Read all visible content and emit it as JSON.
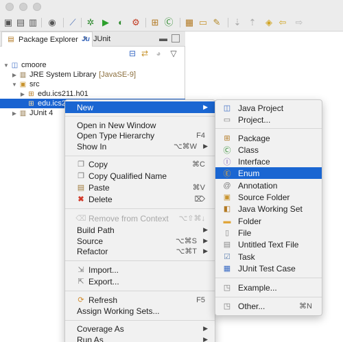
{
  "package_explorer": {
    "tab_label": "Package Explorer",
    "junit_tab_label": "JUnit",
    "tree": [
      {
        "label": "cmoore",
        "level": 0
      },
      {
        "label": "JRE System Library",
        "decoration": "[JavaSE-9]",
        "level": 1
      },
      {
        "label": "src",
        "level": 1
      },
      {
        "label": "edu.ics211.h01",
        "level": 2
      },
      {
        "label": "edu.ics2",
        "level": 2,
        "selected": true
      },
      {
        "label": "JUnit 4",
        "level": 1
      }
    ]
  },
  "context_menu": {
    "items": {
      "new": "New",
      "open_new_window": "Open in New Window",
      "open_type_hierarchy": "Open Type Hierarchy",
      "open_type_hierarchy_sc": "F4",
      "show_in": "Show In",
      "show_in_sc": "⌥⌘W",
      "copy": "Copy",
      "copy_sc": "⌘C",
      "copy_qualified": "Copy Qualified Name",
      "paste": "Paste",
      "paste_sc": "⌘V",
      "delete": "Delete",
      "delete_sc": "⌦",
      "remove_context": "Remove from Context",
      "remove_context_sc": "⌥⇧⌘↓",
      "build_path": "Build Path",
      "source": "Source",
      "source_sc": "⌥⌘S",
      "refactor": "Refactor",
      "refactor_sc": "⌥⌘T",
      "import": "Import...",
      "export": "Export...",
      "refresh": "Refresh",
      "refresh_sc": "F5",
      "assign_working_sets": "Assign Working Sets...",
      "coverage_as": "Coverage As",
      "run_as": "Run As"
    }
  },
  "new_submenu": {
    "items": {
      "java_project": "Java Project",
      "project": "Project...",
      "package": "Package",
      "class": "Class",
      "interface": "Interface",
      "enum": "Enum",
      "annotation": "Annotation",
      "source_folder": "Source Folder",
      "java_working_set": "Java Working Set",
      "folder": "Folder",
      "file": "File",
      "untitled_text_file": "Untitled Text File",
      "task": "Task",
      "junit_test_case": "JUnit Test Case",
      "example": "Example...",
      "other": "Other...",
      "other_sc": "⌘N"
    }
  },
  "colors": {
    "selection": "#1a66d2",
    "menu_bg": "#f1f1f1"
  }
}
